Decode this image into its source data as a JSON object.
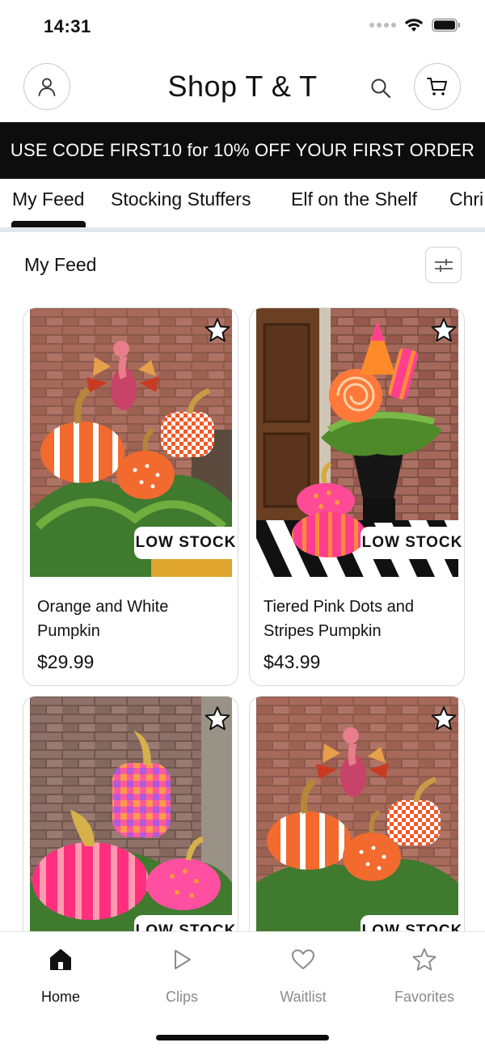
{
  "status_bar": {
    "time": "14:31"
  },
  "header": {
    "title": "Shop T & T",
    "account_icon": "person-icon",
    "search_icon": "search-icon",
    "cart_icon": "cart-icon"
  },
  "promo": {
    "text": "USE CODE FIRST10 for 10% OFF YOUR FIRST ORDER"
  },
  "tabs": [
    {
      "label": "My Feed",
      "active": true
    },
    {
      "label": "Stocking Stuffers",
      "active": false
    },
    {
      "label": "Elf on the Shelf",
      "active": false
    },
    {
      "label": "Chri",
      "active": false
    }
  ],
  "feed": {
    "title": "My Feed",
    "filter_icon": "sliders-icon",
    "products": [
      {
        "name": "Orange and White Pumpkin",
        "price": "$29.99",
        "badge": "LOW STOCK",
        "favorited": false
      },
      {
        "name": "Tiered Pink Dots and Stripes Pumpkin",
        "price": "$43.99",
        "badge": "LOW STOCK",
        "favorited": false
      },
      {
        "name": "",
        "price": "",
        "badge": "LOW STOCK",
        "favorited": false
      },
      {
        "name": "",
        "price": "",
        "badge": "LOW STOCK",
        "favorited": false
      }
    ]
  },
  "bottom_nav": [
    {
      "label": "Home",
      "icon": "home-icon",
      "active": true
    },
    {
      "label": "Clips",
      "icon": "play-icon",
      "active": false
    },
    {
      "label": "Waitlist",
      "icon": "heart-icon",
      "active": false
    },
    {
      "label": "Favorites",
      "icon": "star-icon",
      "active": false
    }
  ],
  "colors": {
    "banner_bg": "#0d0d0d",
    "accent_orange": "#f26a2e",
    "accent_pink": "#ff3f8e",
    "inactive_nav": "#8a8a8a"
  }
}
